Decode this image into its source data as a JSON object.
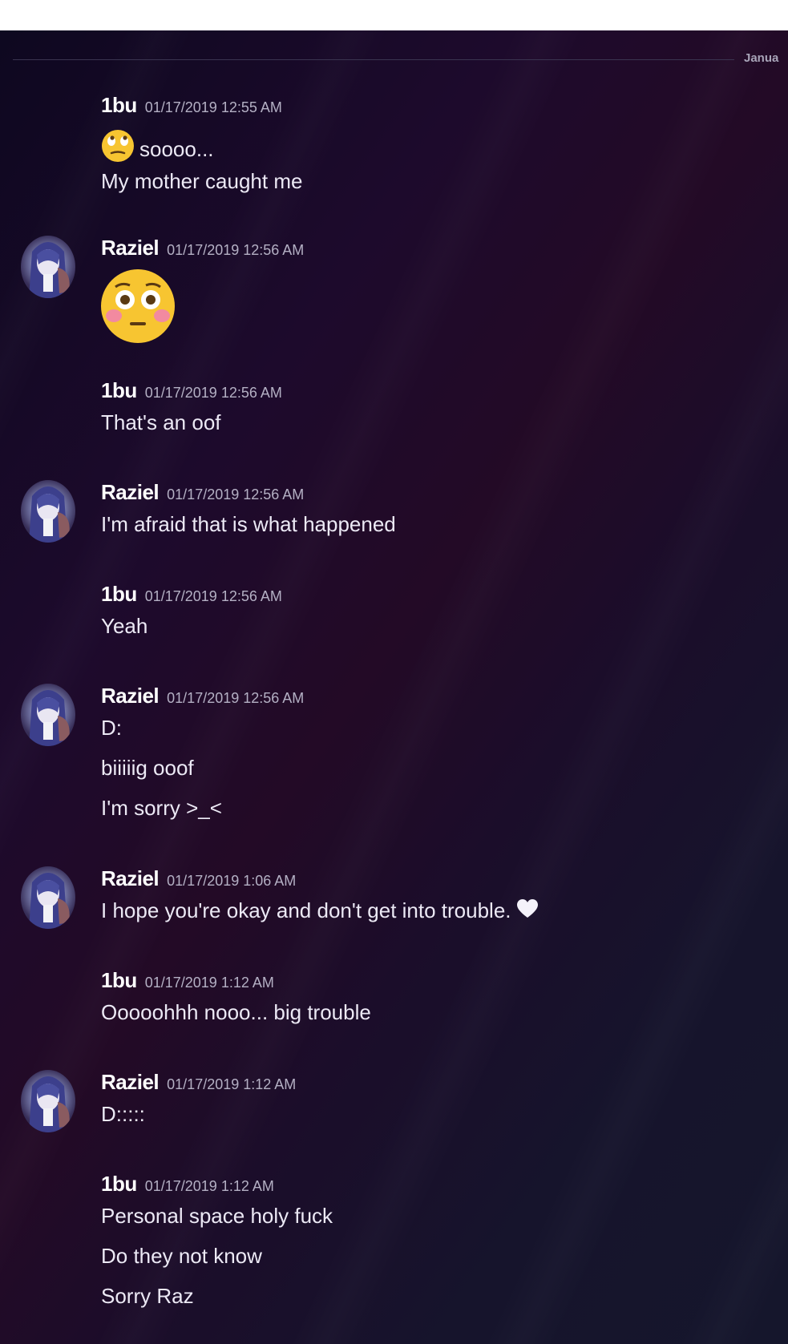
{
  "divider": {
    "label": "Janua"
  },
  "messages": [
    {
      "author": "1bu",
      "timestamp": "01/17/2019 12:55 AM",
      "lines": [
        "sоооо...",
        "My mother caught me"
      ]
    },
    {
      "author": "Raziel",
      "timestamp": "01/17/2019 12:56 AM",
      "lines": []
    },
    {
      "author": "1bu",
      "timestamp": "01/17/2019 12:56 AM",
      "lines": [
        "That's an oof"
      ]
    },
    {
      "author": "Raziel",
      "timestamp": "01/17/2019 12:56 AM",
      "lines": [
        "I'm afraid that is what happened"
      ]
    },
    {
      "author": "1bu",
      "timestamp": "01/17/2019 12:56 AM",
      "lines": [
        "Yeah"
      ]
    },
    {
      "author": "Raziel",
      "timestamp": "01/17/2019 12:56 AM",
      "lines": [
        "D:",
        "biiiiig ooof",
        "I'm sorry >_<"
      ]
    },
    {
      "author": "Raziel",
      "timestamp": "01/17/2019 1:06 AM",
      "lines": [
        "I hope you're okay and don't get into trouble."
      ]
    },
    {
      "author": "1bu",
      "timestamp": "01/17/2019 1:12 AM",
      "lines": [
        "Ooooohhh nooo... big trouble"
      ]
    },
    {
      "author": "Raziel",
      "timestamp": "01/17/2019 1:12 AM",
      "lines": [
        "D:::::"
      ]
    },
    {
      "author": "1bu",
      "timestamp": "01/17/2019 1:12 AM",
      "lines": [
        "Personal space holy fuck",
        "Do they not know",
        "Sorry Raz"
      ]
    }
  ],
  "icons": {
    "avatar": "raziel-avatar",
    "emoji_1": "rolling-eyes-emoji",
    "emoji_2": "flushed-emoji",
    "emoji_3": "white-heart-emoji"
  }
}
